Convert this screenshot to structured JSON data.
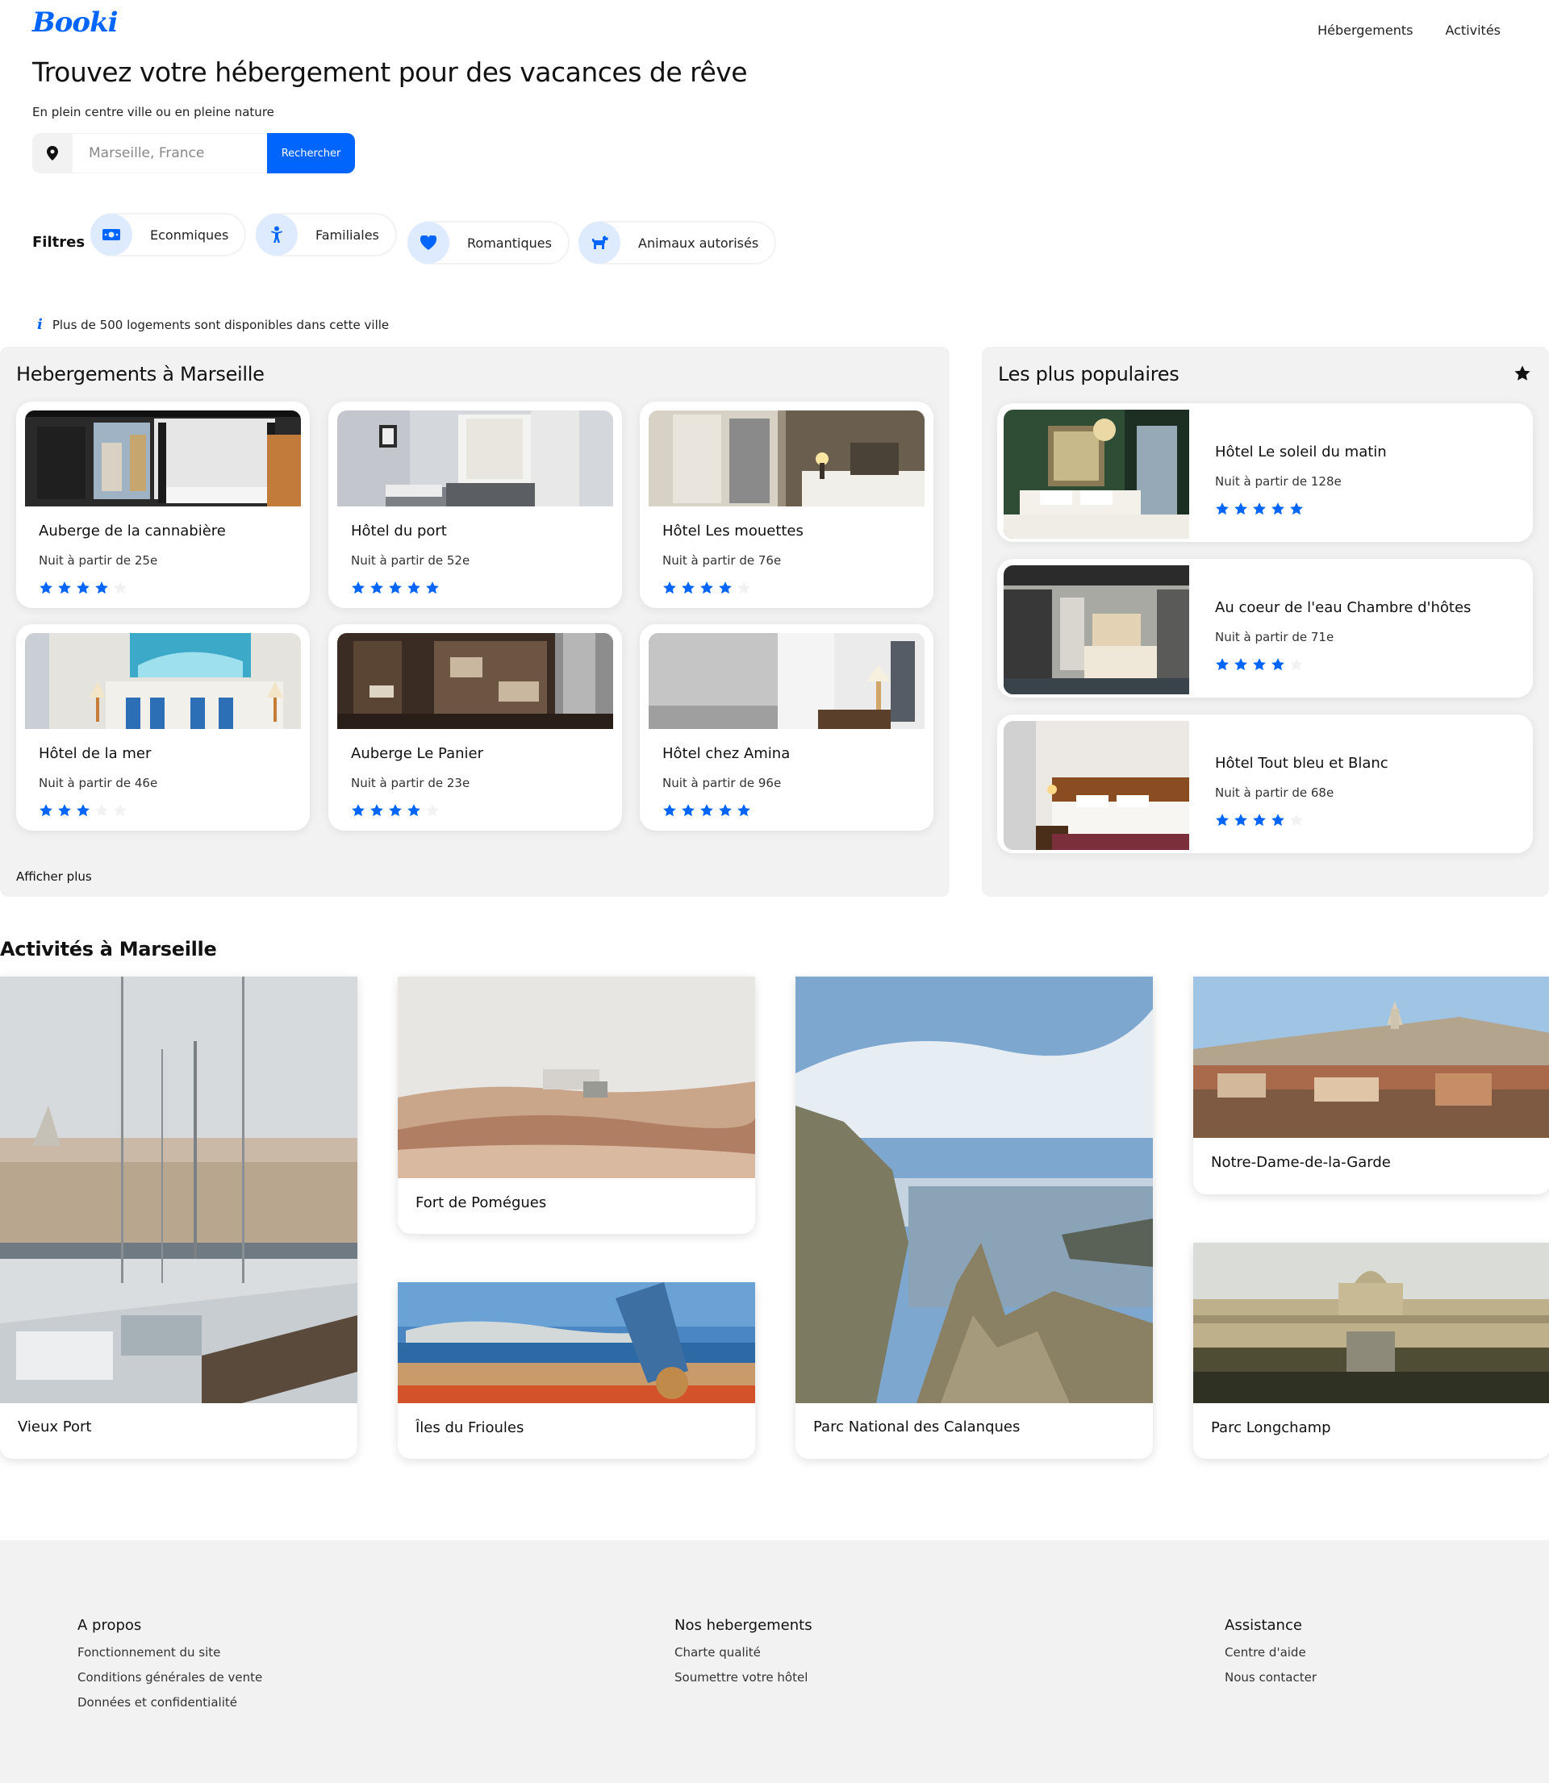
{
  "header": {
    "logo": "Booki",
    "nav": [
      "Hébergements",
      "Activités"
    ]
  },
  "hero": {
    "title": "Trouvez votre hébergement pour des vacances de rêve",
    "subtitle": "En plein centre ville ou en pleine nature"
  },
  "search": {
    "placeholder": "Marseille, France",
    "button": "Rechercher"
  },
  "filters": {
    "label": "Filtres",
    "items": [
      {
        "label": "Econmiques",
        "icon": "money-bill-icon"
      },
      {
        "label": "Familiales",
        "icon": "child-icon"
      },
      {
        "label": "Romantiques",
        "icon": "heart-icon"
      },
      {
        "label": "Animaux autorisés",
        "icon": "dog-icon"
      }
    ]
  },
  "info": "Plus de 500 logements sont disponibles dans cette ville",
  "accommodations": {
    "title": "Hebergements à Marseille",
    "more": "Afficher plus",
    "items": [
      {
        "name": "Auberge de la cannabière",
        "price": "Nuit à partir de 25e",
        "rating": 4
      },
      {
        "name": "Hôtel du port",
        "price": "Nuit à partir de 52e",
        "rating": 5
      },
      {
        "name": "Hôtel Les mouettes",
        "price": "Nuit à partir de 76e",
        "rating": 4
      },
      {
        "name": "Hôtel de la mer",
        "price": "Nuit à partir de 46e",
        "rating": 3
      },
      {
        "name": "Auberge Le Panier",
        "price": "Nuit à partir de 23e",
        "rating": 4
      },
      {
        "name": "Hôtel chez Amina",
        "price": "Nuit à partir de 96e",
        "rating": 5
      }
    ]
  },
  "popular": {
    "title": "Les plus populaires",
    "items": [
      {
        "name": "Hôtel Le soleil du matin",
        "price": "Nuit à partir de 128e",
        "rating": 5
      },
      {
        "name": "Au coeur de l'eau Chambre d'hôtes",
        "price": "Nuit à partir de 71e",
        "rating": 4
      },
      {
        "name": "Hôtel Tout bleu et Blanc",
        "price": "Nuit à partir de 68e",
        "rating": 4
      }
    ]
  },
  "activities": {
    "title": "Activités à Marseille",
    "items": [
      "Vieux Port",
      "Fort de Pomégues",
      "Îles du Frioules",
      "Parc National des Calanques",
      "Notre-Dame-de-la-Garde",
      "Parc Longchamp"
    ]
  },
  "footer": {
    "columns": [
      {
        "title": "A propos",
        "links": [
          "Fonctionnement du site",
          "Conditions générales de vente",
          "Données et confidentialité"
        ]
      },
      {
        "title": "Nos hebergements",
        "links": [
          "Charte qualité",
          "Soumettre votre hôtel"
        ]
      },
      {
        "title": "Assistance",
        "links": [
          "Centre d'aide",
          "Nous contacter"
        ]
      }
    ]
  },
  "colors": {
    "accent": "#0065FC",
    "accent_light": "#DEEBFF",
    "panel": "#F2F2F2",
    "star_off": "#F2F2F2"
  }
}
